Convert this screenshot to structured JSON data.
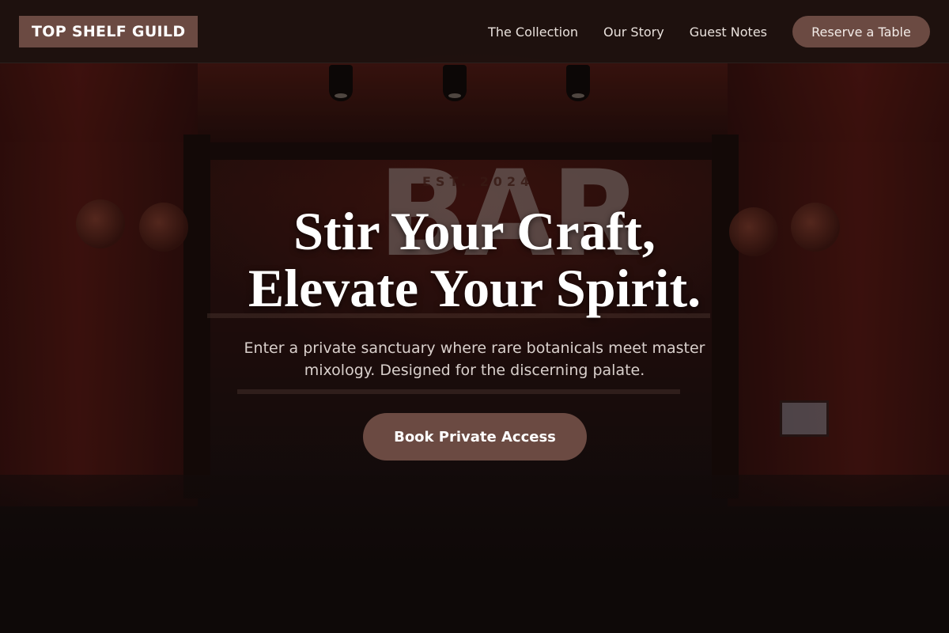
{
  "brand": {
    "logo_text": "TOP SHELF GUILD"
  },
  "nav": {
    "links": [
      "The Collection",
      "Our Story",
      "Guest Notes"
    ],
    "reserve_label": "Reserve a Table"
  },
  "hero": {
    "headline_line1": "Stir Your Craft,",
    "headline_line2": "Elevate Your Spirit.",
    "subtitle": "Enter a private sanctuary where rare botanicals meet master mixology. Designed for the discerning palate.",
    "cta_label": "Book Private Access",
    "background_sign_text": "BAR",
    "background_est_text": "EST. 2024"
  },
  "colors": {
    "accent": "#6b4a42",
    "nav_bg": "#1e1210",
    "text_light": "#e9e1dc"
  }
}
